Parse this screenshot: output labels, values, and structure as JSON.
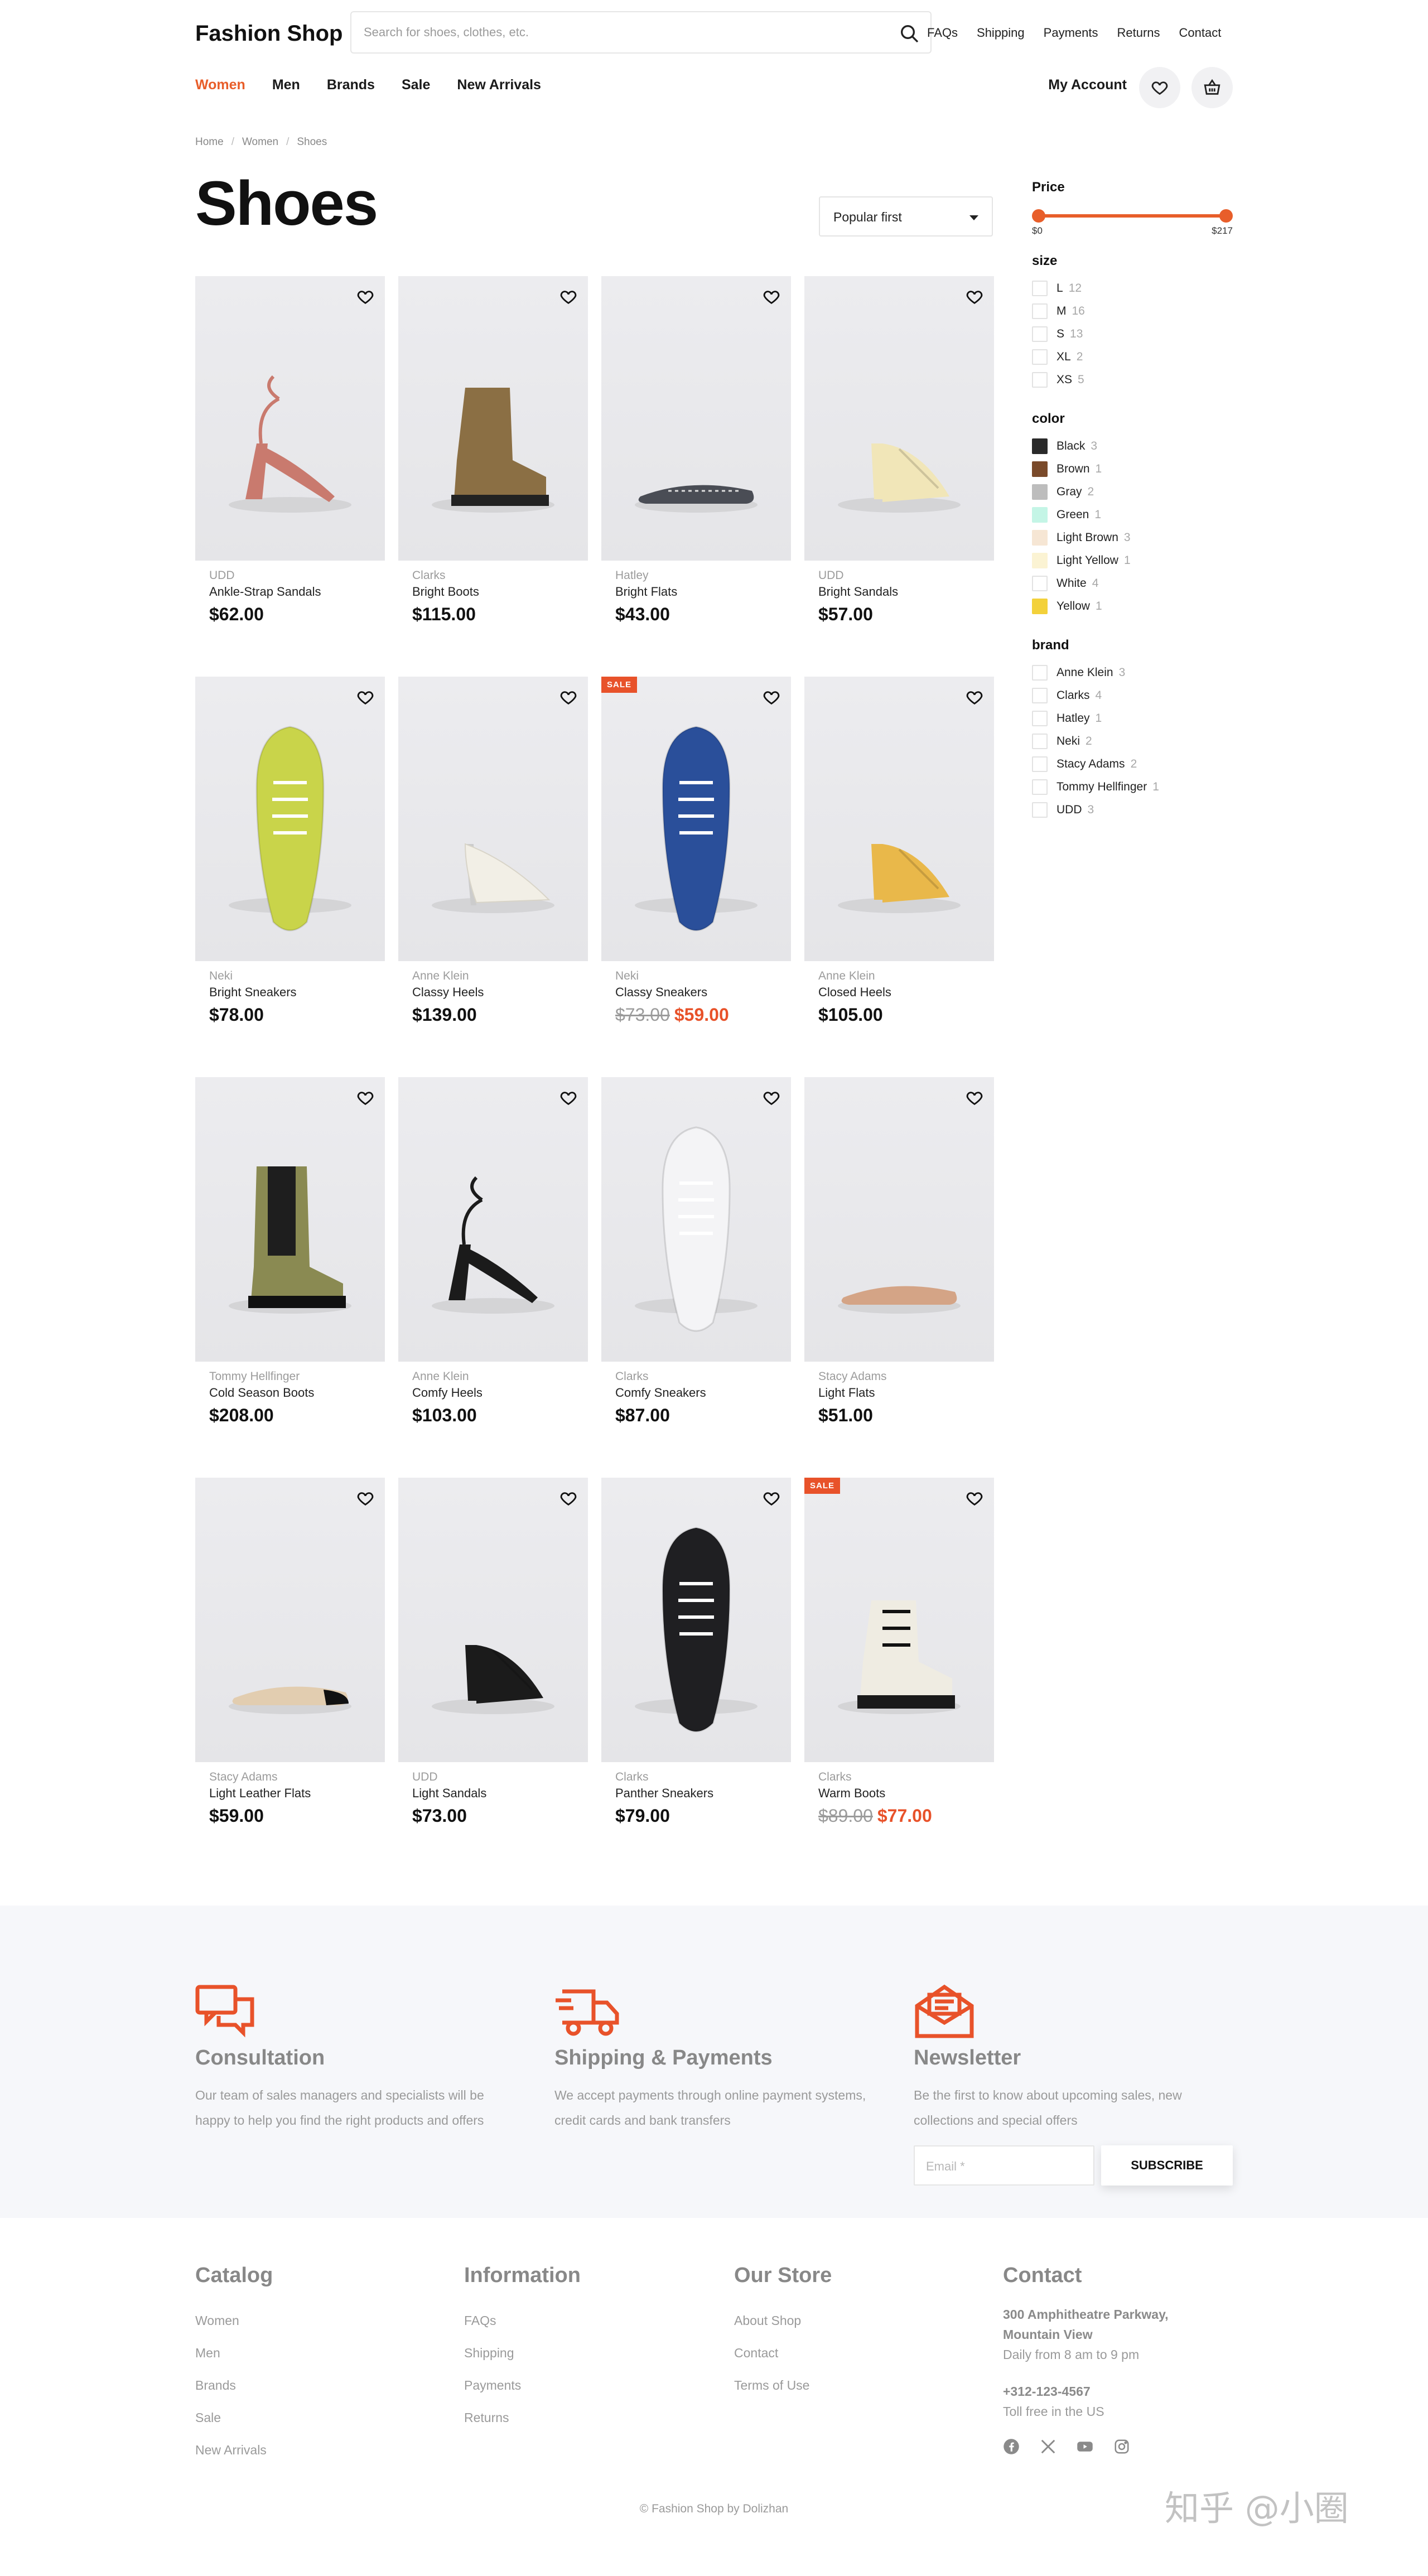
{
  "header": {
    "logo": "Fashion Shop",
    "search_placeholder": "Search for shoes, clothes, etc.",
    "top_links": [
      "FAQs",
      "Shipping",
      "Payments",
      "Returns",
      "Contact"
    ],
    "nav": [
      "Women",
      "Men",
      "Brands",
      "Sale",
      "New Arrivals"
    ],
    "active_nav": "Women",
    "account_label": "My Account"
  },
  "breadcrumb": [
    "Home",
    "Women",
    "Shoes"
  ],
  "page_title": "Shoes",
  "sort": {
    "selected": "Popular first"
  },
  "products": [
    {
      "brand": "UDD",
      "name": "Ankle-Strap Sandals",
      "price": "$62.00",
      "sale": false,
      "shoe_color": "#c97a6e"
    },
    {
      "brand": "Clarks",
      "name": "Bright Boots",
      "price": "$115.00",
      "sale": false,
      "shoe_color": "#8b6f44"
    },
    {
      "brand": "Hatley",
      "name": "Bright Flats",
      "price": "$43.00",
      "sale": false,
      "shoe_color": "#4a4d55"
    },
    {
      "brand": "UDD",
      "name": "Bright Sandals",
      "price": "$57.00",
      "sale": false,
      "shoe_color": "#f1e6b8"
    },
    {
      "brand": "Neki",
      "name": "Bright Sneakers",
      "price": "$78.00",
      "sale": false,
      "shoe_color": "#c9d44a"
    },
    {
      "brand": "Anne Klein",
      "name": "Classy Heels",
      "price": "$139.00",
      "sale": false,
      "shoe_color": "#f2efe6"
    },
    {
      "brand": "Neki",
      "name": "Classy Sneakers",
      "old_price": "$73.00",
      "price": "$59.00",
      "sale": true,
      "sale_label": "SALE",
      "shoe_color": "#2a4f9a"
    },
    {
      "brand": "Anne Klein",
      "name": "Closed Heels",
      "price": "$105.00",
      "sale": false,
      "shoe_color": "#e9b84a"
    },
    {
      "brand": "Tommy Hellfinger",
      "name": "Cold Season Boots",
      "price": "$208.00",
      "sale": false,
      "shoe_color": "#8a8a52"
    },
    {
      "brand": "Anne Klein",
      "name": "Comfy Heels",
      "price": "$103.00",
      "sale": false,
      "shoe_color": "#1b1b1b"
    },
    {
      "brand": "Clarks",
      "name": "Comfy Sneakers",
      "price": "$87.00",
      "sale": false,
      "shoe_color": "#f4f4f6"
    },
    {
      "brand": "Stacy Adams",
      "name": "Light Flats",
      "price": "$51.00",
      "sale": false,
      "shoe_color": "#d4a486"
    },
    {
      "brand": "Stacy Adams",
      "name": "Light Leather Flats",
      "price": "$59.00",
      "sale": false,
      "shoe_color": "#e2cdb0"
    },
    {
      "brand": "UDD",
      "name": "Light Sandals",
      "price": "$73.00",
      "sale": false,
      "shoe_color": "#1b1b1b"
    },
    {
      "brand": "Clarks",
      "name": "Panther Sneakers",
      "price": "$79.00",
      "sale": false,
      "shoe_color": "#1f1f22"
    },
    {
      "brand": "Clarks",
      "name": "Warm Boots",
      "old_price": "$89.00",
      "price": "$77.00",
      "sale": true,
      "sale_label": "SALE",
      "shoe_color": "#efece2"
    }
  ],
  "filters": {
    "price": {
      "title": "Price",
      "min_label": "$0",
      "max_label": "$217"
    },
    "size": {
      "title": "size",
      "items": [
        {
          "label": "L",
          "count": "12"
        },
        {
          "label": "M",
          "count": "16"
        },
        {
          "label": "S",
          "count": "13"
        },
        {
          "label": "XL",
          "count": "2"
        },
        {
          "label": "XS",
          "count": "5"
        }
      ]
    },
    "color": {
      "title": "color",
      "items": [
        {
          "label": "Black",
          "count": "3",
          "swatch": "#2a2a2a"
        },
        {
          "label": "Brown",
          "count": "1",
          "swatch": "#7a4a2a"
        },
        {
          "label": "Gray",
          "count": "2",
          "swatch": "#bdbdbd"
        },
        {
          "label": "Green",
          "count": "1",
          "swatch": "#c4f5e6"
        },
        {
          "label": "Light Brown",
          "count": "3",
          "swatch": "#f6e6d4"
        },
        {
          "label": "Light Yellow",
          "count": "1",
          "swatch": "#fbf3d3"
        },
        {
          "label": "White",
          "count": "4",
          "swatch": "#ffffff"
        },
        {
          "label": "Yellow",
          "count": "1",
          "swatch": "#f3d13a"
        }
      ]
    },
    "brand": {
      "title": "brand",
      "items": [
        {
          "label": "Anne Klein",
          "count": "3"
        },
        {
          "label": "Clarks",
          "count": "4"
        },
        {
          "label": "Hatley",
          "count": "1"
        },
        {
          "label": "Neki",
          "count": "2"
        },
        {
          "label": "Stacy Adams",
          "count": "2"
        },
        {
          "label": "Tommy Hellfinger",
          "count": "1"
        },
        {
          "label": "UDD",
          "count": "3"
        }
      ]
    }
  },
  "features": [
    {
      "title": "Consultation",
      "text": "Our team of sales managers and specialists will be happy to help you find the right products and offers",
      "icon": "chat-icon"
    },
    {
      "title": "Shipping & Payments",
      "text": "We accept payments through online payment systems, credit cards and bank transfers",
      "icon": "truck-icon"
    },
    {
      "title": "Newsletter",
      "text": "Be the first to know about upcoming sales, new collections and special offers",
      "icon": "mail-icon"
    }
  ],
  "newsletter": {
    "email_placeholder": "Email *",
    "subscribe_label": "SUBSCRIBE"
  },
  "footer": {
    "catalog": {
      "title": "Catalog",
      "links": [
        "Women",
        "Men",
        "Brands",
        "Sale",
        "New Arrivals"
      ]
    },
    "information": {
      "title": "Information",
      "links": [
        "FAQs",
        "Shipping",
        "Payments",
        "Returns"
      ]
    },
    "store": {
      "title": "Our Store",
      "links": [
        "About Shop",
        "Contact",
        "Terms of Use"
      ]
    },
    "contact": {
      "title": "Contact",
      "address_line1": "300 Amphitheatre Parkway,",
      "address_line2": "Mountain View",
      "hours": "Daily from 8 am to 9 pm",
      "phone": "+312-123-4567",
      "phone_note": "Toll free in the US"
    },
    "copyright": "© Fashion Shop by Dolizhan",
    "watermark": "知乎 @小圈"
  },
  "colors": {
    "accent": "#e85e2a",
    "text": "#1f1f1f",
    "muted": "#9a9a9a"
  }
}
